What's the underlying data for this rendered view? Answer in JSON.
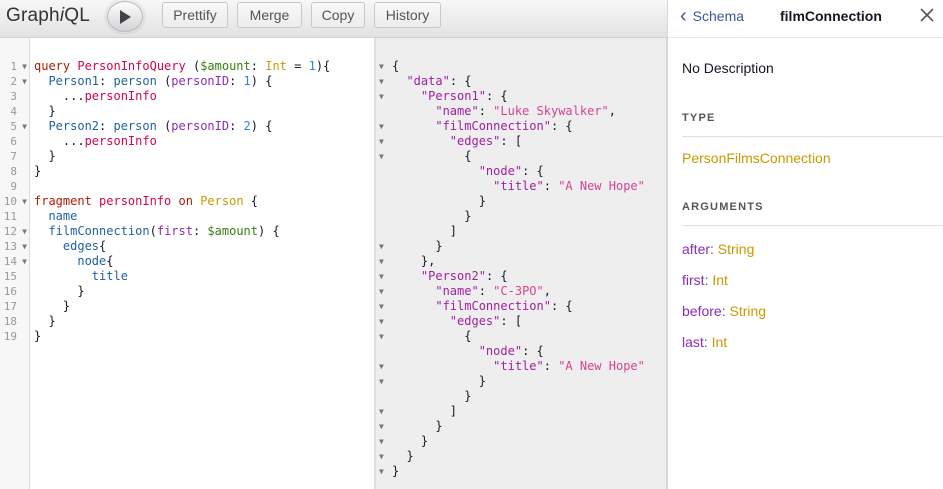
{
  "toolbar": {
    "logo_pre": "Graph",
    "logo_i": "i",
    "logo_post": "QL",
    "buttons": [
      "Prettify",
      "Merge",
      "Copy",
      "History"
    ]
  },
  "query_editor": {
    "line_numbers": [
      "1",
      "2",
      "3",
      "4",
      "5",
      "6",
      "7",
      "8",
      "9",
      "10",
      "11",
      "12",
      "13",
      "14",
      "15",
      "16",
      "17",
      "18",
      "19"
    ],
    "fold_lines": [
      1,
      2,
      5,
      10,
      12,
      13,
      14
    ],
    "lines": [
      [
        [
          "query",
          "kw"
        ],
        [
          " ",
          ""
        ],
        [
          "PersonInfoQuery",
          "def"
        ],
        [
          " (",
          ""
        ],
        [
          "$amount",
          "var"
        ],
        [
          ": ",
          ""
        ],
        [
          "Int",
          "type"
        ],
        [
          " = ",
          ""
        ],
        [
          "1",
          "num-t"
        ],
        [
          "){",
          ""
        ]
      ],
      [
        [
          "  ",
          ""
        ],
        [
          "Person1",
          "prop"
        ],
        [
          ": ",
          ""
        ],
        [
          "person",
          "prop"
        ],
        [
          " (",
          ""
        ],
        [
          "personID",
          "attr"
        ],
        [
          ": ",
          ""
        ],
        [
          "1",
          "num-t"
        ],
        [
          ") {",
          ""
        ]
      ],
      [
        [
          "    ...",
          ""
        ],
        [
          "personInfo",
          "def"
        ]
      ],
      [
        [
          "  }",
          ""
        ]
      ],
      [
        [
          "  ",
          ""
        ],
        [
          "Person2",
          "prop"
        ],
        [
          ": ",
          ""
        ],
        [
          "person",
          "prop"
        ],
        [
          " (",
          ""
        ],
        [
          "personID",
          "attr"
        ],
        [
          ": ",
          ""
        ],
        [
          "2",
          "num-t"
        ],
        [
          ") {",
          ""
        ]
      ],
      [
        [
          "    ...",
          ""
        ],
        [
          "personInfo",
          "def"
        ]
      ],
      [
        [
          "  }",
          ""
        ]
      ],
      [
        [
          "}",
          ""
        ]
      ],
      [
        [
          "",
          ""
        ]
      ],
      [
        [
          "fragment",
          "kw"
        ],
        [
          " ",
          ""
        ],
        [
          "personInfo",
          "def"
        ],
        [
          " ",
          ""
        ],
        [
          "on",
          "kw"
        ],
        [
          " ",
          ""
        ],
        [
          "Person",
          "type"
        ],
        [
          " {",
          ""
        ]
      ],
      [
        [
          "  ",
          ""
        ],
        [
          "name",
          "prop"
        ]
      ],
      [
        [
          "  ",
          ""
        ],
        [
          "filmConnection",
          "prop"
        ],
        [
          "(",
          ""
        ],
        [
          "first",
          "attr"
        ],
        [
          ": ",
          ""
        ],
        [
          "$amount",
          "var"
        ],
        [
          ") {",
          ""
        ]
      ],
      [
        [
          "    ",
          ""
        ],
        [
          "edges",
          "prop"
        ],
        [
          "{",
          ""
        ]
      ],
      [
        [
          "      ",
          ""
        ],
        [
          "node",
          "prop"
        ],
        [
          "{",
          ""
        ]
      ],
      [
        [
          "        ",
          ""
        ],
        [
          "title",
          "prop"
        ]
      ],
      [
        [
          "      }",
          ""
        ]
      ],
      [
        [
          "    }",
          ""
        ]
      ],
      [
        [
          "  }",
          ""
        ]
      ],
      [
        [
          "}",
          ""
        ]
      ]
    ]
  },
  "result_viewer": {
    "fold_lines": [
      1,
      2,
      3,
      5,
      6,
      7,
      13,
      14,
      15,
      16,
      17,
      18,
      19,
      21,
      22,
      24,
      25,
      26,
      27,
      28,
      29,
      30
    ],
    "lines": [
      [
        [
          "{",
          ""
        ]
      ],
      [
        [
          "  ",
          ""
        ],
        [
          "\"data\"",
          "jkey"
        ],
        [
          ": {",
          ""
        ]
      ],
      [
        [
          "    ",
          ""
        ],
        [
          "\"Person1\"",
          "jkey"
        ],
        [
          ": {",
          ""
        ]
      ],
      [
        [
          "      ",
          ""
        ],
        [
          "\"name\"",
          "jkey"
        ],
        [
          ": ",
          ""
        ],
        [
          "\"Luke Skywalker\"",
          "jstr"
        ],
        [
          ",",
          ""
        ]
      ],
      [
        [
          "      ",
          ""
        ],
        [
          "\"filmConnection\"",
          "jkey"
        ],
        [
          ": {",
          ""
        ]
      ],
      [
        [
          "        ",
          ""
        ],
        [
          "\"edges\"",
          "jkey"
        ],
        [
          ": [",
          ""
        ]
      ],
      [
        [
          "          {",
          ""
        ]
      ],
      [
        [
          "            ",
          ""
        ],
        [
          "\"node\"",
          "jkey"
        ],
        [
          ": {",
          ""
        ]
      ],
      [
        [
          "              ",
          ""
        ],
        [
          "\"title\"",
          "jkey"
        ],
        [
          ": ",
          ""
        ],
        [
          "\"A New Hope\"",
          "jstr"
        ]
      ],
      [
        [
          "            }",
          ""
        ]
      ],
      [
        [
          "          }",
          ""
        ]
      ],
      [
        [
          "        ]",
          ""
        ]
      ],
      [
        [
          "      }",
          ""
        ]
      ],
      [
        [
          "    },",
          ""
        ]
      ],
      [
        [
          "    ",
          ""
        ],
        [
          "\"Person2\"",
          "jkey"
        ],
        [
          ": {",
          ""
        ]
      ],
      [
        [
          "      ",
          ""
        ],
        [
          "\"name\"",
          "jkey"
        ],
        [
          ": ",
          ""
        ],
        [
          "\"C-3PO\"",
          "jstr"
        ],
        [
          ",",
          ""
        ]
      ],
      [
        [
          "      ",
          ""
        ],
        [
          "\"filmConnection\"",
          "jkey"
        ],
        [
          ": {",
          ""
        ]
      ],
      [
        [
          "        ",
          ""
        ],
        [
          "\"edges\"",
          "jkey"
        ],
        [
          ": [",
          ""
        ]
      ],
      [
        [
          "          {",
          ""
        ]
      ],
      [
        [
          "            ",
          ""
        ],
        [
          "\"node\"",
          "jkey"
        ],
        [
          ": {",
          ""
        ]
      ],
      [
        [
          "              ",
          ""
        ],
        [
          "\"title\"",
          "jkey"
        ],
        [
          ": ",
          ""
        ],
        [
          "\"A New Hope\"",
          "jstr"
        ]
      ],
      [
        [
          "            }",
          ""
        ]
      ],
      [
        [
          "          }",
          ""
        ]
      ],
      [
        [
          "        ]",
          ""
        ]
      ],
      [
        [
          "      }",
          ""
        ]
      ],
      [
        [
          "    }",
          ""
        ]
      ],
      [
        [
          "  }",
          ""
        ]
      ],
      [
        [
          "}",
          ""
        ]
      ]
    ]
  },
  "docs": {
    "back_label": "Schema",
    "title": "filmConnection",
    "description": "No Description",
    "type_section_title": "TYPE",
    "type_name": "PersonFilmsConnection",
    "arguments_section_title": "ARGUMENTS",
    "arguments": [
      {
        "name": "after",
        "sep": ": ",
        "type": "String"
      },
      {
        "name": "first",
        "sep": ": ",
        "type": "Int"
      },
      {
        "name": "before",
        "sep": ": ",
        "type": "String"
      },
      {
        "name": "last",
        "sep": ": ",
        "type": "Int"
      }
    ]
  }
}
